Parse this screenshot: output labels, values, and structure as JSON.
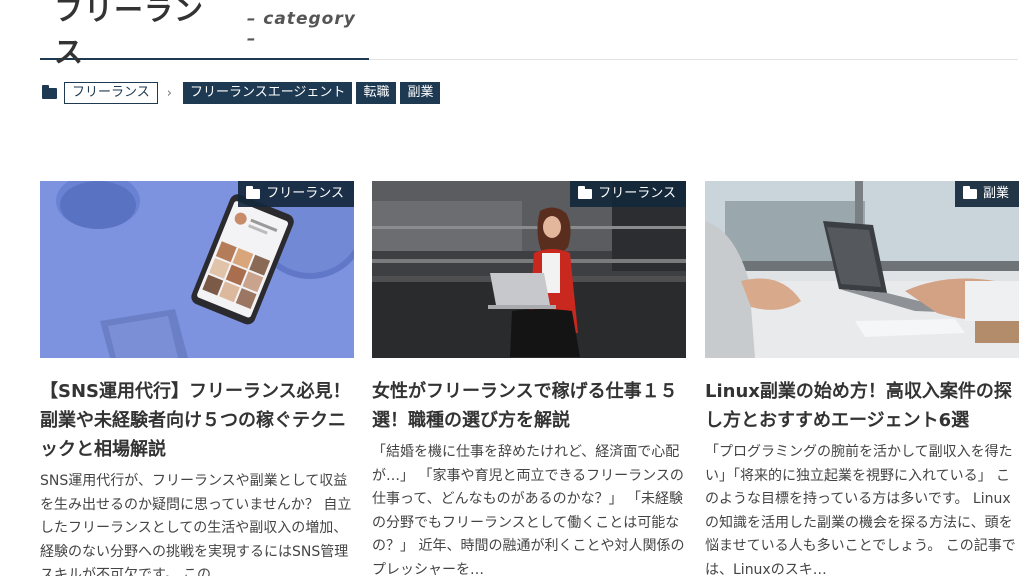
{
  "header": {
    "title": "フリーランス",
    "subtitle": "– category –"
  },
  "breadcrumb": {
    "current": "フリーランス",
    "children": [
      "フリーランスエージェント",
      "転職",
      "副業"
    ]
  },
  "cards": [
    {
      "category": "フリーランス",
      "title": "【SNS運用代行】フリーランス必見！副業や未経験者向け５つの稼ぐテクニックと相場解説",
      "excerpt": "SNS運用代行が、フリーランスや副業として収益を生み出せるのか疑問に思っていませんか？ 自立したフリーランスとしての生活や副収入の増加、経験のない分野への挑戦を実現するにはSNS管理スキルが不可欠です。 この"
    },
    {
      "category": "フリーランス",
      "title": "女性がフリーランスで稼げる仕事１５選！職種の選び方を解説",
      "excerpt": "「結婚を機に仕事を辞めたけれど、経済面で心配が…」 「家事や育児と両立できるフリーランスの仕事って、どんなものがあるのかな？」 「未経験の分野でもフリーランスとして働くことは可能なの？」 近年、時間の融通が利くことや対人関係のプレッシャーを…"
    },
    {
      "category": "副業",
      "title": "Linux副業の始め方！高収入案件の探し方とおすすめエージェント6選",
      "excerpt": "「プログラミングの腕前を活かして副収入を得たい」「将来的に独立起業を視野に入れている」 このような目標を持っている方は多いです。 Linuxの知識を活用した副業の機会を探る方法に、頭を悩ませている人も多いことでしょう。 この記事では、Linuxのスキ…"
    }
  ],
  "colors": {
    "accent": "#1e3a52",
    "text": "#333333"
  }
}
